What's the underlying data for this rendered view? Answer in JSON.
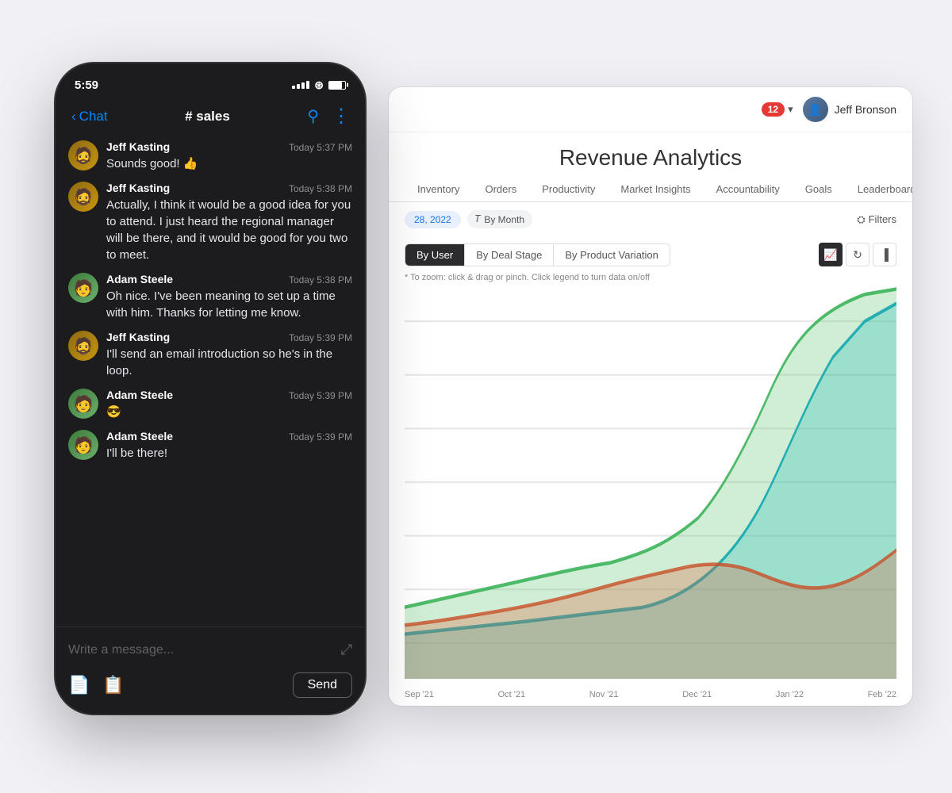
{
  "phone": {
    "statusBar": {
      "time": "5:59",
      "signal": "....",
      "battery": "battery"
    },
    "navBar": {
      "backLabel": "Chat",
      "channel": "# sales"
    },
    "messages": [
      {
        "author": "Jeff Kasting",
        "time": "Today 5:37 PM",
        "text": "Sounds good! 👍",
        "avatarType": "jeff"
      },
      {
        "author": "Jeff Kasting",
        "time": "Today 5:38 PM",
        "text": "Actually, I think it would be a good idea for you to attend. I just heard the regional manager will be there, and it would be good for you two to meet.",
        "avatarType": "jeff"
      },
      {
        "author": "Adam Steele",
        "time": "Today 5:38 PM",
        "text": "Oh nice. I've been meaning to set up a time with him. Thanks for letting me know.",
        "avatarType": "adam"
      },
      {
        "author": "Jeff Kasting",
        "time": "Today 5:39 PM",
        "text": "I'll send an email introduction so he's in the loop.",
        "avatarType": "jeff"
      },
      {
        "author": "Adam Steele",
        "time": "Today 5:39 PM",
        "text": "😎",
        "avatarType": "adam"
      },
      {
        "author": "Adam Steele",
        "time": "Today 5:39 PM",
        "text": "I'll be there!",
        "avatarType": "adam"
      }
    ],
    "inputPlaceholder": "Write a message...",
    "sendButton": "Send"
  },
  "desktop": {
    "notificationCount": "12",
    "userName": "Jeff Bronson",
    "pageTitle": "Revenue Analytics",
    "tabs": [
      {
        "label": "Inventory"
      },
      {
        "label": "Orders"
      },
      {
        "label": "Productivity"
      },
      {
        "label": "Market Insights"
      },
      {
        "label": "Accountability"
      },
      {
        "label": "Goals"
      },
      {
        "label": "Leaderboard"
      }
    ],
    "filters": {
      "dateChip": "28, 2022",
      "byMonthChip": "By Month",
      "filtersLabel": "Filters"
    },
    "chartControls": {
      "groupBy": [
        {
          "label": "By User",
          "active": true
        },
        {
          "label": "By Deal Stage",
          "active": false
        },
        {
          "label": "By Product Variation",
          "active": false
        }
      ],
      "iconButtons": [
        "📈",
        "🔄",
        "📊"
      ]
    },
    "chartHint": "* To zoom: click & drag or pinch. Click legend to turn data on/off",
    "xAxisLabels": [
      "Sep '21",
      "Oct '21",
      "Nov '21",
      "Dec '21",
      "Jan '22",
      "Feb '22"
    ]
  }
}
